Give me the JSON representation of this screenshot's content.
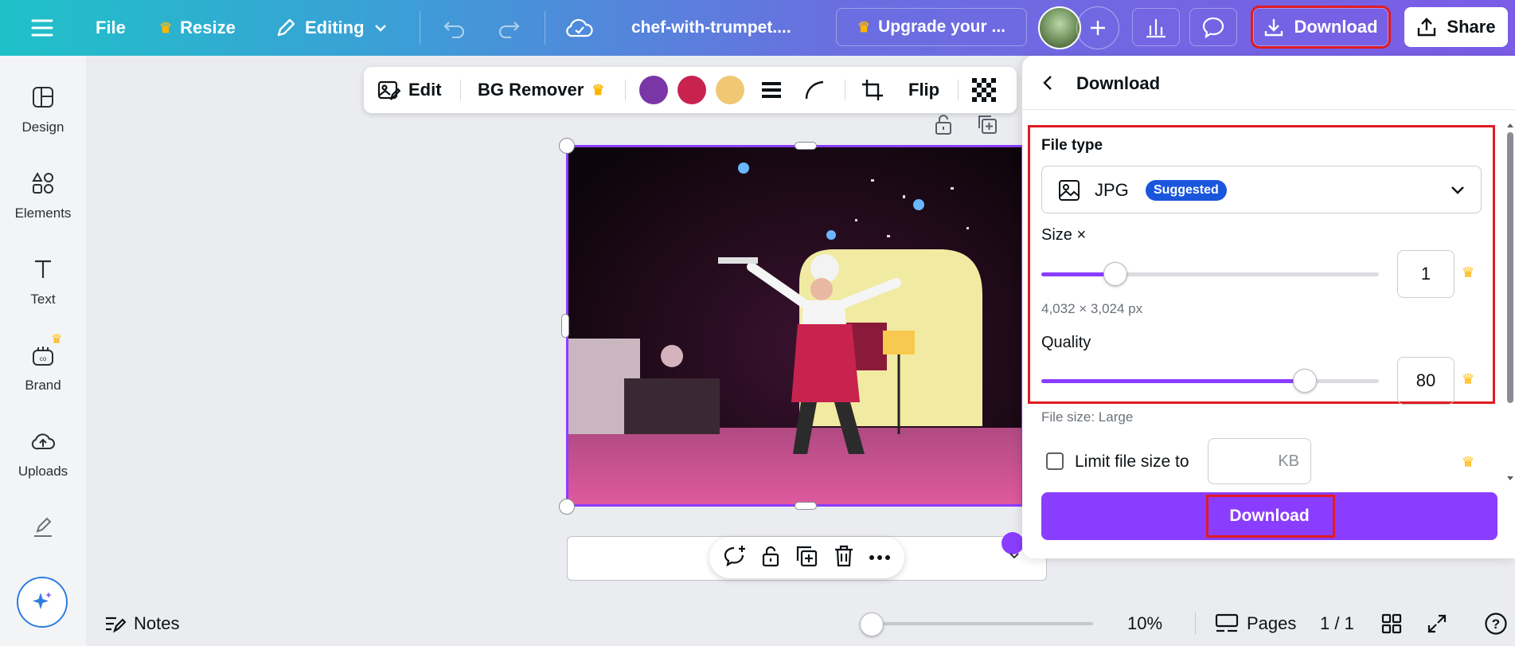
{
  "topbar": {
    "file_label": "File",
    "resize_label": "Resize",
    "editing_label": "Editing",
    "doc_title": "chef-with-trumpet....",
    "upgrade_label": "Upgrade your ...",
    "download_label": "Download",
    "share_label": "Share"
  },
  "sidebar": {
    "items": [
      {
        "label": "Design",
        "icon": "design-icon"
      },
      {
        "label": "Elements",
        "icon": "elements-icon"
      },
      {
        "label": "Text",
        "icon": "text-icon"
      },
      {
        "label": "Brand",
        "icon": "brand-icon"
      },
      {
        "label": "Uploads",
        "icon": "uploads-icon"
      },
      {
        "label": "",
        "icon": "draw-icon"
      }
    ]
  },
  "context_toolbar": {
    "edit_label": "Edit",
    "bg_remover_label": "BG Remover",
    "flip_label": "Flip",
    "swatch_colors": [
      "#7a35a6",
      "#c8234e",
      "#f0c773"
    ]
  },
  "bottombar": {
    "notes_label": "Notes",
    "zoom_value": "10%",
    "pages_label": "Pages",
    "page_counter": "1 / 1"
  },
  "download_panel": {
    "title": "Download",
    "file_type_label": "File type",
    "file_type_value": "JPG",
    "suggested_badge": "Suggested",
    "size_label": "Size ×",
    "size_value": "1",
    "size_fraction": 0.22,
    "dimensions_text": "4,032 × 3,024 px",
    "quality_label": "Quality",
    "quality_value": "80",
    "quality_fraction": 0.78,
    "file_size_text": "File size: Large",
    "limit_label": "Limit file size to",
    "kb_placeholder": "KB",
    "download_button_label": "Download"
  },
  "colors": {
    "accent": "#8b3dff",
    "highlight": "#e01b24",
    "crown": "#ffb400"
  }
}
